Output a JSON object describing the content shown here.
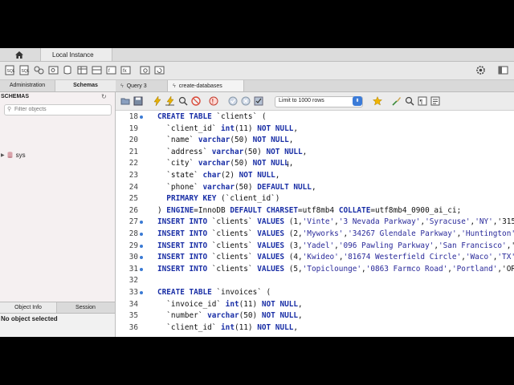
{
  "tabs": {
    "instance": "Local Instance"
  },
  "sidebar": {
    "tab_admin": "Administration",
    "tab_schemas": "Schemas",
    "schemas_header": "SCHEMAS",
    "filter_placeholder": "Filter objects",
    "tree": [
      {
        "label": "sys"
      }
    ],
    "lower_tab_info": "Object Info",
    "lower_tab_session": "Session",
    "no_object": "No object selected"
  },
  "editor": {
    "tabs": [
      {
        "label": "Query 3"
      },
      {
        "label": "create-databases"
      }
    ],
    "limit_value": "Limit to 1000 rows",
    "lines": [
      {
        "n": "18",
        "dot": true,
        "text": "CREATE TABLE `clients` ("
      },
      {
        "n": "19",
        "dot": false,
        "text": "  `client_id` int(11) NOT NULL,"
      },
      {
        "n": "20",
        "dot": false,
        "text": "  `name` varchar(50) NOT NULL,"
      },
      {
        "n": "21",
        "dot": false,
        "text": "  `address` varchar(50) NOT NULL,"
      },
      {
        "n": "22",
        "dot": false,
        "text": "  `city` varchar(50) NOT NULL,"
      },
      {
        "n": "23",
        "dot": false,
        "text": "  `state` char(2) NOT NULL,"
      },
      {
        "n": "24",
        "dot": false,
        "text": "  `phone` varchar(50) DEFAULT NULL,"
      },
      {
        "n": "25",
        "dot": false,
        "text": "  PRIMARY KEY (`client_id`)"
      },
      {
        "n": "26",
        "dot": false,
        "text": ") ENGINE=InnoDB DEFAULT CHARSET=utf8mb4 COLLATE=utf8mb4_0900_ai_ci;"
      },
      {
        "n": "27",
        "dot": true,
        "text": "INSERT INTO `clients` VALUES (1,'Vinte','3 Nevada Parkway','Syracuse','NY','315"
      },
      {
        "n": "28",
        "dot": true,
        "text": "INSERT INTO `clients` VALUES (2,'Myworks','34267 Glendale Parkway','Huntington'"
      },
      {
        "n": "29",
        "dot": true,
        "text": "INSERT INTO `clients` VALUES (3,'Yadel','096 Pawling Parkway','San Francisco','"
      },
      {
        "n": "30",
        "dot": true,
        "text": "INSERT INTO `clients` VALUES (4,'Kwideo','81674 Westerfield Circle','Waco','TX'"
      },
      {
        "n": "31",
        "dot": true,
        "text": "INSERT INTO `clients` VALUES (5,'Topiclounge','0863 Farmco Road','Portland','OR"
      },
      {
        "n": "32",
        "dot": false,
        "text": ""
      },
      {
        "n": "33",
        "dot": true,
        "text": "CREATE TABLE `invoices` ("
      },
      {
        "n": "34",
        "dot": false,
        "text": "  `invoice_id` int(11) NOT NULL,"
      },
      {
        "n": "35",
        "dot": false,
        "text": "  `number` varchar(50) NOT NULL,"
      },
      {
        "n": "36",
        "dot": false,
        "text": "  `client_id` int(11) NOT NULL,"
      }
    ]
  },
  "colors": {
    "keyword": "#1a2fa6",
    "accent_blue": "#3b7bd8"
  }
}
